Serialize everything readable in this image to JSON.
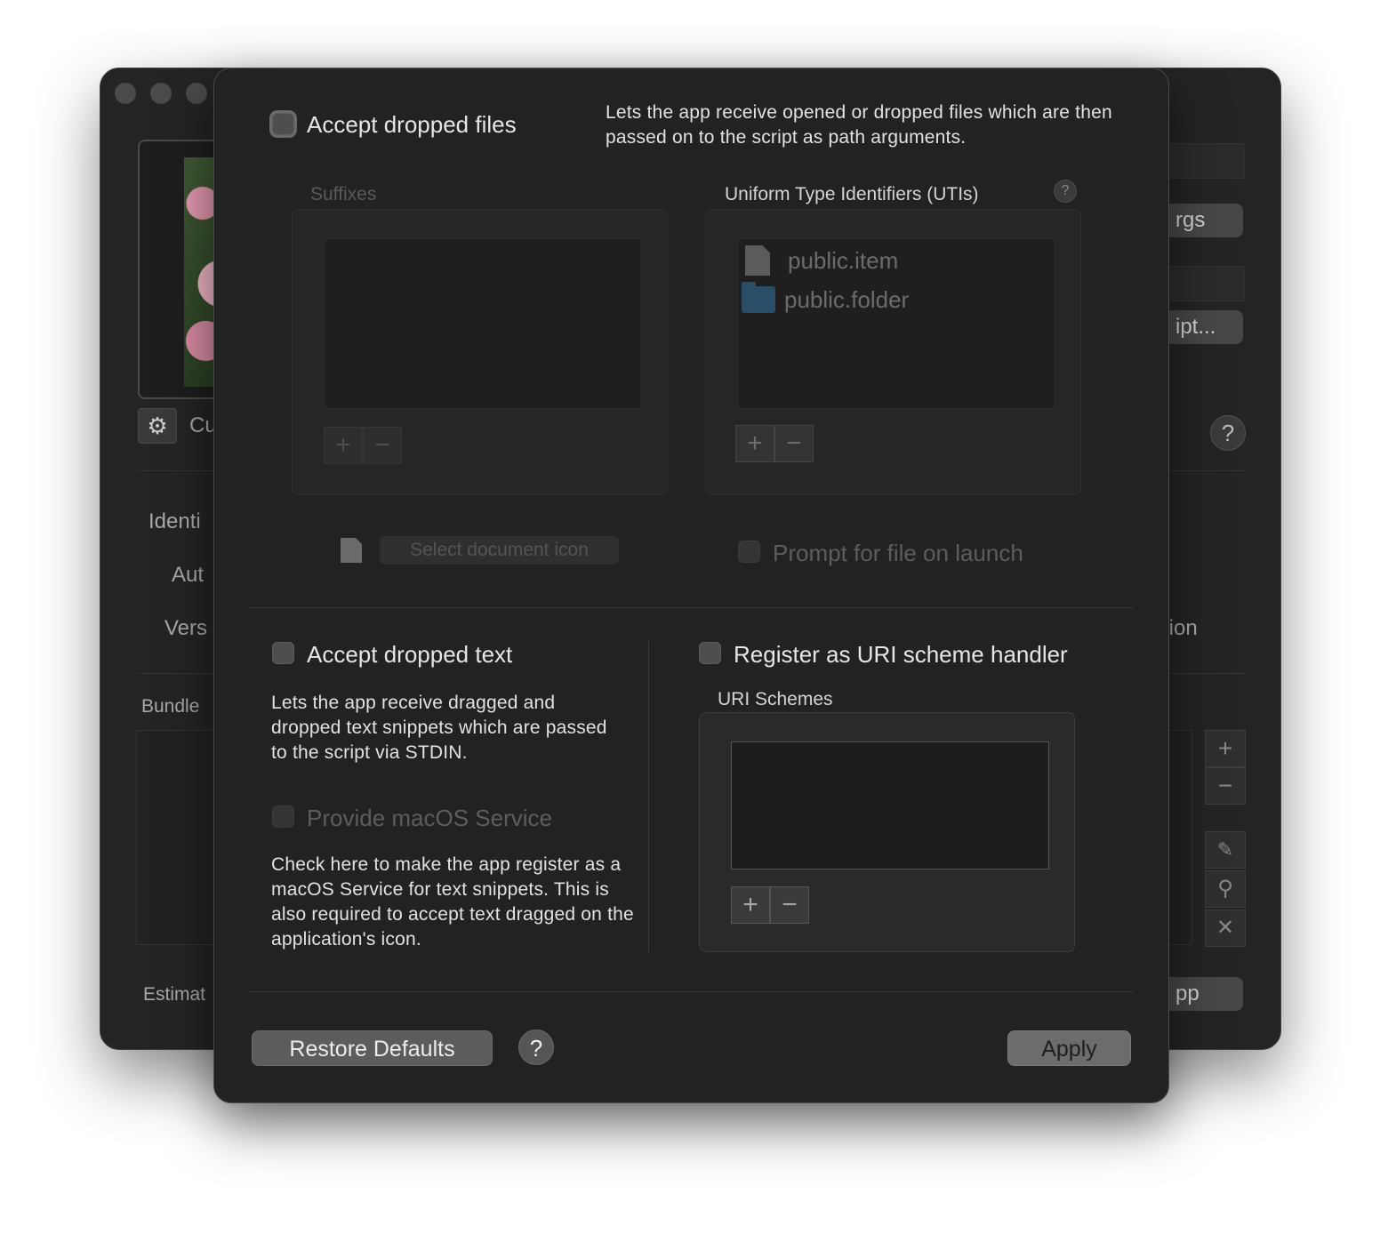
{
  "background_window": {
    "custom_label": "Cu",
    "identifier_label": "Identi",
    "author_label": "Aut",
    "version_label": "Vers",
    "bundled_label": "Bundle",
    "estimated_label": "Estimat",
    "args_button": "rgs",
    "script_button": "ipt...",
    "option_label": "tion",
    "app_button": "pp",
    "help": "?",
    "add": "+",
    "remove": "−",
    "close": "✕"
  },
  "sheet": {
    "files": {
      "checkbox_label": "Accept dropped files",
      "description": "Lets the app receive opened or dropped files which are then passed on to the script as path arguments.",
      "suffixes_title": "Suffixes",
      "utis_title": "Uniform Type Identifiers (UTIs)",
      "utis_help": "?",
      "utis": [
        {
          "name": "public.item",
          "icon": "document-icon"
        },
        {
          "name": "public.folder",
          "icon": "folder-icon"
        }
      ],
      "add": "+",
      "remove": "−",
      "select_doc_icon": "Select document icon",
      "prompt_on_launch": "Prompt for file on launch"
    },
    "text": {
      "checkbox_label": "Accept dropped text",
      "description": "Lets the app receive dragged and dropped text snippets which are passed to the script via STDIN.",
      "service_label": "Provide macOS Service",
      "service_description": "Check here to make the app register as a macOS Service for text snippets. This is also required to accept text dragged on the application's icon."
    },
    "uri": {
      "checkbox_label": "Register as URI scheme handler",
      "schemes_title": "URI Schemes",
      "add": "+",
      "remove": "−"
    },
    "footer": {
      "restore_defaults": "Restore Defaults",
      "help": "?",
      "apply": "Apply"
    }
  }
}
